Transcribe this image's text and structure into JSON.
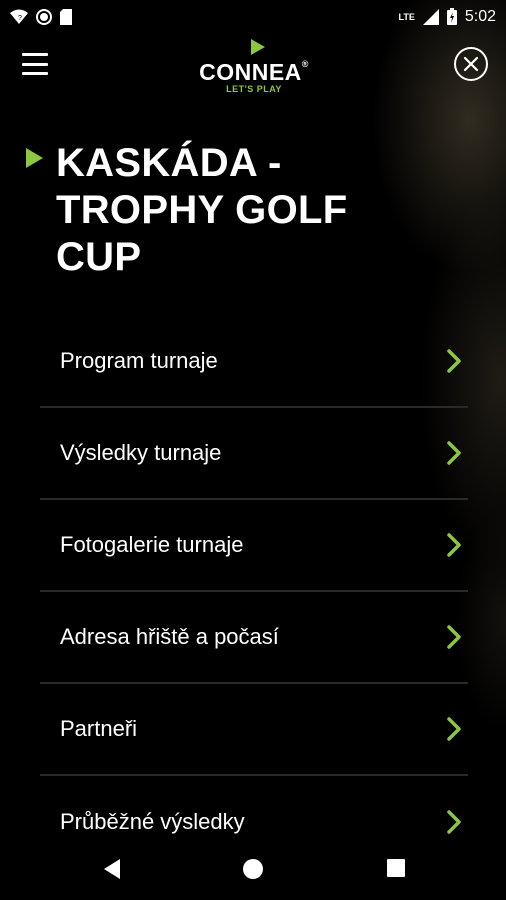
{
  "status_bar": {
    "time": "5:02",
    "network": "LTE",
    "icons": [
      "wifi-icon",
      "circle-icon",
      "sd-card-icon",
      "signal-icon",
      "battery-icon"
    ]
  },
  "header": {
    "logo_word": "CONNEA",
    "logo_registered": "®",
    "logo_tagline": "LET'S PLAY",
    "menu_icon": "hamburger-menu-icon",
    "close_icon": "close-circle-icon"
  },
  "page": {
    "title_line1": "KASKÁDA -",
    "title_line2": "TROPHY GOLF",
    "title_line3": "CUP"
  },
  "menu": {
    "items": [
      {
        "label": "Program turnaje"
      },
      {
        "label": "Výsledky turnaje"
      },
      {
        "label": "Fotogalerie turnaje"
      },
      {
        "label": "Adresa hřiště a počasí"
      },
      {
        "label": "Partneři"
      },
      {
        "label": "Průběžné výsledky"
      }
    ]
  },
  "nav_bar": {
    "buttons": [
      "back-icon",
      "home-icon",
      "recents-icon"
    ]
  },
  "colors": {
    "accent": "#8dc63f",
    "background": "#000000",
    "text": "#ffffff",
    "divider": "#2a2a2a"
  }
}
